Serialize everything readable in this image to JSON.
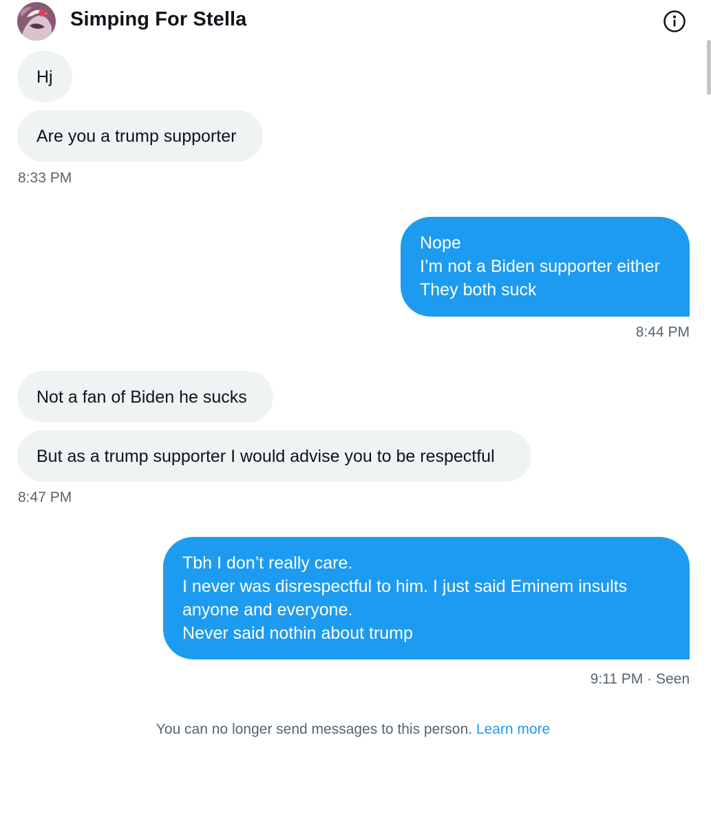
{
  "header": {
    "title": "Simping For Stella",
    "avatar_icon": "profile-avatar",
    "info_icon": "info-circle-icon"
  },
  "messages": [
    {
      "from": "them",
      "text": "Hj"
    },
    {
      "from": "them",
      "text": "Are you a trump supporter"
    },
    {
      "from": "them",
      "timestamp": "8:33 PM"
    },
    {
      "from": "me",
      "lines": [
        "Nope",
        "I’m not a Biden supporter either",
        "They both suck"
      ],
      "timestamp": "8:44 PM"
    },
    {
      "from": "them",
      "text": "Not a fan of Biden he sucks"
    },
    {
      "from": "them",
      "text": "But as a trump supporter I would advise you to be respectful"
    },
    {
      "from": "them",
      "timestamp": "8:47 PM"
    },
    {
      "from": "me",
      "lines": [
        "Tbh I don’t really care.",
        "I never was disrespectful to him. I just said Eminem insults",
        "anyone and everyone.",
        "Never said nothin about trump"
      ],
      "timestamp": "9:11 PM · Seen"
    }
  ],
  "footer": {
    "notice": "You can no longer send messages to this person.",
    "link": "Learn more"
  },
  "colors": {
    "outgoing_bubble": "#1d9bf0",
    "incoming_bubble": "#eff3f4",
    "secondary_text": "#536471",
    "link": "#1d9bf0"
  }
}
